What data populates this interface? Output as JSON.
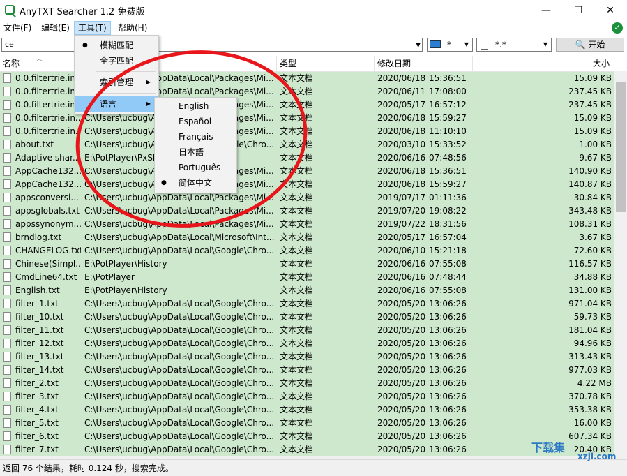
{
  "window": {
    "title": "AnyTXT Searcher 1.2 免费版",
    "minimize": "—",
    "maximize": "☐",
    "close": "✕"
  },
  "menubar": [
    "文件(F)",
    "编辑(E)",
    "工具(T)",
    "帮助(H)"
  ],
  "status_ok": "✓",
  "toolbar": {
    "search_value": "ce",
    "drive_value": "*",
    "filetype_value": "*.*",
    "start_label": "开始"
  },
  "columns": {
    "name": "名称",
    "path": "路径",
    "type": "类型",
    "modified": "修改日期",
    "size": "大小"
  },
  "tools_menu": {
    "items": [
      {
        "label": "模糊匹配",
        "checked": true
      },
      {
        "label": "全字匹配"
      },
      {
        "label": "索引管理",
        "submenu": true
      },
      {
        "label": "语言",
        "submenu": true,
        "highlighted": true
      }
    ]
  },
  "language_menu": [
    "English",
    "Español",
    "Français",
    "日本語",
    "Português",
    "简体中文"
  ],
  "language_selected": "简体中文",
  "rows": [
    [
      "0.0.filtertrie.in...",
      "C:\\Users\\ucbug\\AppData\\Local\\Packages\\Mi...",
      "文本文档",
      "2020/06/18",
      "15:36:51",
      "15.09 KB"
    ],
    [
      "0.0.filtertrie.in...",
      "C:\\Users\\ucbug\\AppData\\Local\\Packages\\Mi...",
      "文本文档",
      "2020/06/11",
      "17:08:00",
      "237.45 KB"
    ],
    [
      "0.0.filtertrie.in...",
      "C:\\Users\\ucbug\\AppData\\Local\\Packages\\Mi...",
      "文本文档",
      "2020/05/17",
      "16:57:12",
      "237.45 KB"
    ],
    [
      "0.0.filtertrie.in...",
      "C:\\Users\\ucbug\\AppData\\Local\\Packages\\Mi...",
      "文本文档",
      "2020/06/18",
      "15:59:27",
      "15.09 KB"
    ],
    [
      "0.0.filtertrie.in...",
      "C:\\Users\\ucbug\\AppData\\Local\\Packages\\Mi...",
      "文本文档",
      "2020/06/18",
      "11:10:10",
      "15.09 KB"
    ],
    [
      "about.txt",
      "C:\\Users\\ucbug\\AppData\\Local\\Google\\Chro...",
      "文本文档",
      "2020/03/10",
      "15:33:52",
      "1.00 KB"
    ],
    [
      "Adaptive shar...",
      "E:\\PotPlayer\\PxShader",
      "文本文档",
      "2020/06/16",
      "07:48:56",
      "9.67 KB"
    ],
    [
      "AppCache132...",
      "C:\\Users\\ucbug\\AppData\\Local\\Packages\\Mi...",
      "文本文档",
      "2020/06/18",
      "15:36:51",
      "140.90 KB"
    ],
    [
      "AppCache132...",
      "C:\\Users\\ucbug\\AppData\\Local\\Packages\\Mi...",
      "文本文档",
      "2020/06/18",
      "15:59:27",
      "140.87 KB"
    ],
    [
      "appsconversi...",
      "C:\\Users\\ucbug\\AppData\\Local\\Packages\\Mi...",
      "文本文档",
      "2019/07/17",
      "01:11:36",
      "30.84 KB"
    ],
    [
      "appsglobals.txt",
      "C:\\Users\\ucbug\\AppData\\Local\\Packages\\Mi...",
      "文本文档",
      "2019/07/20",
      "19:08:22",
      "343.48 KB"
    ],
    [
      "appssynonym...",
      "C:\\Users\\ucbug\\AppData\\Local\\Packages\\Mi...",
      "文本文档",
      "2019/07/22",
      "18:31:56",
      "108.31 KB"
    ],
    [
      "brndlog.txt",
      "C:\\Users\\ucbug\\AppData\\Local\\Microsoft\\Int...",
      "文本文档",
      "2020/05/17",
      "16:57:04",
      "3.67 KB"
    ],
    [
      "CHANGELOG.txt",
      "C:\\Users\\ucbug\\AppData\\Local\\Google\\Chro...",
      "文本文档",
      "2020/06/10",
      "15:21:18",
      "72.60 KB"
    ],
    [
      "Chinese(Simpl...",
      "E:\\PotPlayer\\History",
      "文本文档",
      "2020/06/16",
      "07:55:08",
      "116.57 KB"
    ],
    [
      "CmdLine64.txt",
      "E:\\PotPlayer",
      "文本文档",
      "2020/06/16",
      "07:48:44",
      "34.88 KB"
    ],
    [
      "English.txt",
      "E:\\PotPlayer\\History",
      "文本文档",
      "2020/06/16",
      "07:55:08",
      "131.00 KB"
    ],
    [
      "filter_1.txt",
      "C:\\Users\\ucbug\\AppData\\Local\\Google\\Chro...",
      "文本文档",
      "2020/05/20",
      "13:06:26",
      "971.04 KB"
    ],
    [
      "filter_10.txt",
      "C:\\Users\\ucbug\\AppData\\Local\\Google\\Chro...",
      "文本文档",
      "2020/05/20",
      "13:06:26",
      "59.73 KB"
    ],
    [
      "filter_11.txt",
      "C:\\Users\\ucbug\\AppData\\Local\\Google\\Chro...",
      "文本文档",
      "2020/05/20",
      "13:06:26",
      "181.04 KB"
    ],
    [
      "filter_12.txt",
      "C:\\Users\\ucbug\\AppData\\Local\\Google\\Chro...",
      "文本文档",
      "2020/05/20",
      "13:06:26",
      "94.96 KB"
    ],
    [
      "filter_13.txt",
      "C:\\Users\\ucbug\\AppData\\Local\\Google\\Chro...",
      "文本文档",
      "2020/05/20",
      "13:06:26",
      "313.43 KB"
    ],
    [
      "filter_14.txt",
      "C:\\Users\\ucbug\\AppData\\Local\\Google\\Chro...",
      "文本文档",
      "2020/05/20",
      "13:06:26",
      "977.03 KB"
    ],
    [
      "filter_2.txt",
      "C:\\Users\\ucbug\\AppData\\Local\\Google\\Chro...",
      "文本文档",
      "2020/05/20",
      "13:06:26",
      "4.22 MB"
    ],
    [
      "filter_3.txt",
      "C:\\Users\\ucbug\\AppData\\Local\\Google\\Chro...",
      "文本文档",
      "2020/05/20",
      "13:06:26",
      "370.78 KB"
    ],
    [
      "filter_4.txt",
      "C:\\Users\\ucbug\\AppData\\Local\\Google\\Chro...",
      "文本文档",
      "2020/05/20",
      "13:06:26",
      "353.38 KB"
    ],
    [
      "filter_5.txt",
      "C:\\Users\\ucbug\\AppData\\Local\\Google\\Chro...",
      "文本文档",
      "2020/05/20",
      "13:06:26",
      "16.00 KB"
    ],
    [
      "filter_6.txt",
      "C:\\Users\\ucbug\\AppData\\Local\\Google\\Chro...",
      "文本文档",
      "2020/05/20",
      "13:06:26",
      "607.34 KB"
    ],
    [
      "filter_7.txt",
      "C:\\Users\\ucbug\\AppData\\Local\\Google\\Chro...",
      "文本文档",
      "2020/05/20",
      "13:06:26",
      "20.40 KB"
    ]
  ],
  "status_text": "返回 76 个结果，耗时 0.124 秒，搜索完成。",
  "watermark": {
    "text": "下载集",
    "domain": "xzji.com"
  },
  "colors": {
    "row_bg": "#cde8cd",
    "annotation_circle": "#e8161a",
    "menu_highlight": "#91c9f7"
  }
}
